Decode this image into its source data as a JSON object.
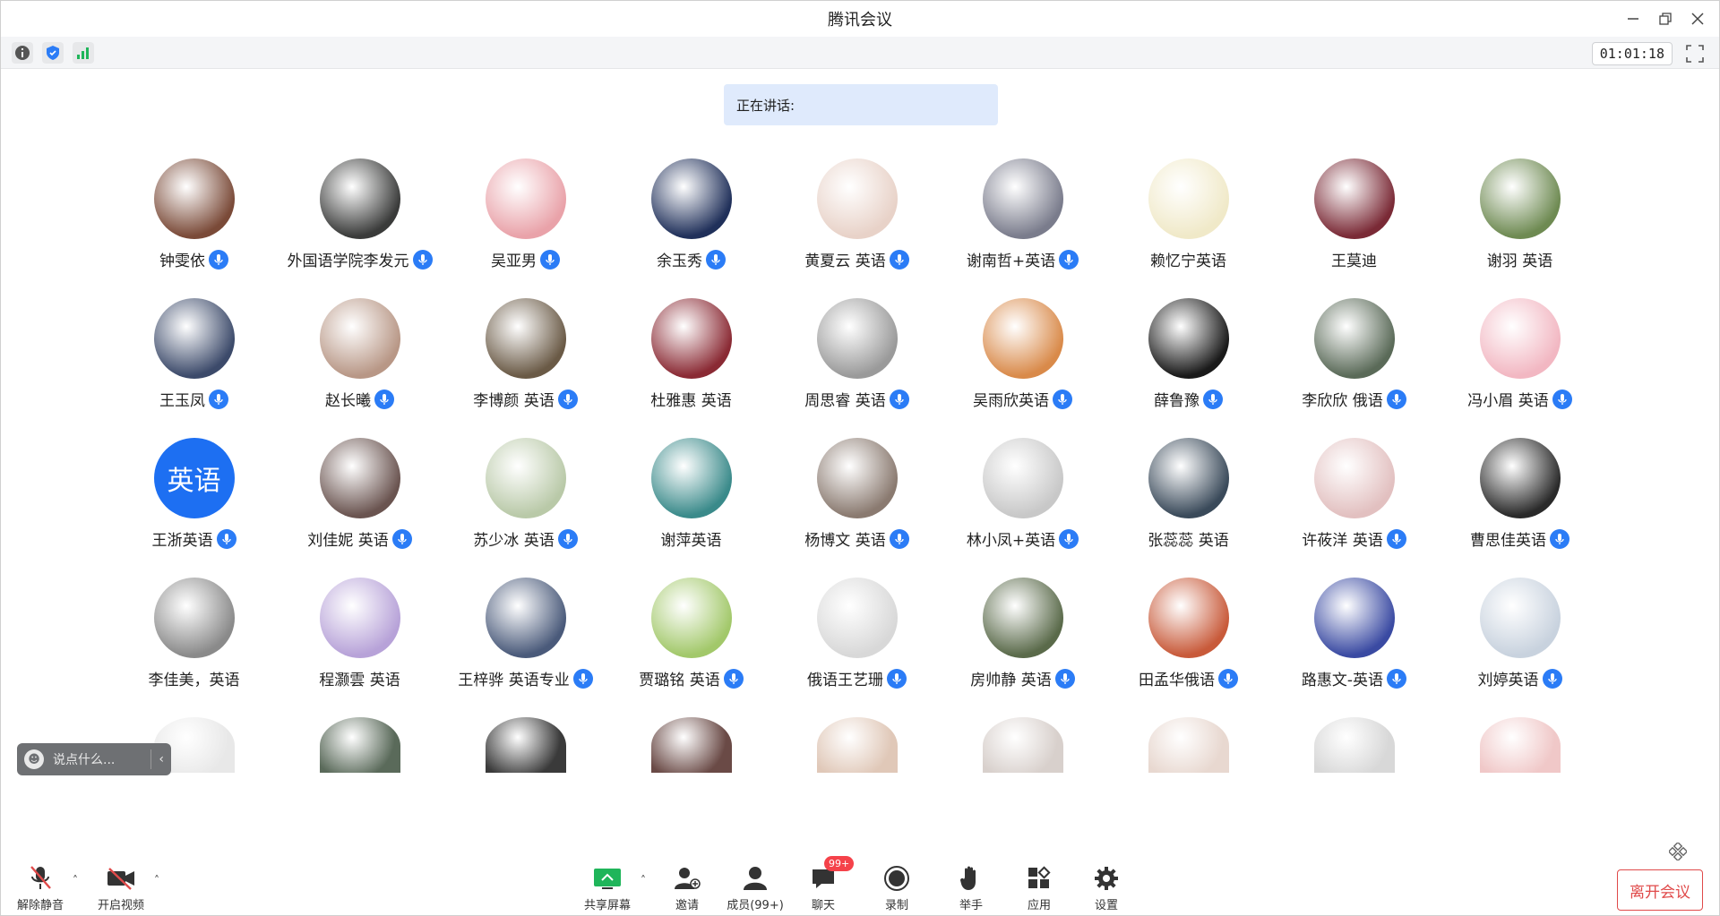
{
  "window": {
    "title": "腾讯会议"
  },
  "toolbar": {
    "timer": "01:01:18"
  },
  "speaking": {
    "label": "正在讲话:"
  },
  "participants": [
    {
      "name": "钟雯依",
      "mic": true,
      "color": "#7a4a38"
    },
    {
      "name": "外国语学院李发元",
      "mic": true,
      "color": "#3a3b3a"
    },
    {
      "name": "吴亚男",
      "mic": true,
      "color": "#e9a2a9"
    },
    {
      "name": "余玉秀",
      "mic": true,
      "color": "#20305a"
    },
    {
      "name": "黄夏云 英语",
      "mic": true,
      "color": "#e8d2c8"
    },
    {
      "name": "谢南哲+英语",
      "mic": true,
      "color": "#7a7c8c"
    },
    {
      "name": "赖忆宁英语",
      "mic": false,
      "color": "#f0e9c8"
    },
    {
      "name": "王莫迪",
      "mic": false,
      "color": "#7a2a36"
    },
    {
      "name": "谢羽 英语",
      "mic": false,
      "color": "#6e8a52"
    },
    {
      "name": "王玉凤",
      "mic": true,
      "color": "#3c4a6a"
    },
    {
      "name": "赵长曦",
      "mic": true,
      "color": "#b89786"
    },
    {
      "name": "李博颜 英语",
      "mic": true,
      "color": "#6a5a46"
    },
    {
      "name": "杜雅惠 英语",
      "mic": false,
      "color": "#8a2a34"
    },
    {
      "name": "周思睿 英语",
      "mic": true,
      "color": "#9a9a9a"
    },
    {
      "name": "吴雨欣英语",
      "mic": true,
      "color": "#d98a4a"
    },
    {
      "name": "薛鲁豫",
      "mic": true,
      "color": "#1a1a1a"
    },
    {
      "name": "李欣欣 俄语",
      "mic": true,
      "color": "#5a6a58"
    },
    {
      "name": "冯小眉 英语",
      "mic": true,
      "color": "#f2b7c2"
    },
    {
      "name": "王浙英语",
      "mic": true,
      "color": "#1d6ff2",
      "avatar_text": "英语"
    },
    {
      "name": "刘佳妮 英语",
      "mic": true,
      "color": "#6a5450"
    },
    {
      "name": "苏少冰 英语",
      "mic": true,
      "color": "#b9c9a8"
    },
    {
      "name": "谢萍英语",
      "mic": false,
      "color": "#3a8a8a"
    },
    {
      "name": "杨博文 英语",
      "mic": true,
      "color": "#8a7a70"
    },
    {
      "name": "林小凤+英语",
      "mic": true,
      "color": "#c8c8c8"
    },
    {
      "name": "张蕊蕊 英语",
      "mic": false,
      "color": "#3a4a5a"
    },
    {
      "name": "许莜洋 英语",
      "mic": true,
      "color": "#e2c0c0"
    },
    {
      "name": "曹思佳英语",
      "mic": true,
      "color": "#2a2a2a"
    },
    {
      "name": "李佳美，英语",
      "mic": false,
      "color": "#8a8a8a"
    },
    {
      "name": "程灏雲 英语",
      "mic": false,
      "color": "#b7a2d8"
    },
    {
      "name": "王梓骅 英语专业",
      "mic": true,
      "color": "#4a5a7a"
    },
    {
      "name": "贾璐铭 英语",
      "mic": true,
      "color": "#a2c86a"
    },
    {
      "name": "俄语王艺珊",
      "mic": true,
      "color": "#d8d8d8"
    },
    {
      "name": "房帅静 英语",
      "mic": true,
      "color": "#5a6a4a"
    },
    {
      "name": "田孟华俄语",
      "mic": true,
      "color": "#c85a3a"
    },
    {
      "name": "路惠文-英语",
      "mic": true,
      "color": "#3a4aa2"
    },
    {
      "name": "刘婷英语",
      "mic": true,
      "color": "#c8d2de"
    }
  ],
  "partial_row": [
    {
      "color": "#e8e8e8"
    },
    {
      "color": "#5a6a5a"
    },
    {
      "color": "#3a3a3a"
    },
    {
      "color": "#6a4a46"
    },
    {
      "color": "#e0c8b8"
    },
    {
      "color": "#d8d0cc"
    },
    {
      "color": "#e8d8d0"
    },
    {
      "color": "#d8d8d8"
    },
    {
      "color": "#f0c8c8"
    }
  ],
  "chat": {
    "placeholder": "说点什么..."
  },
  "bottom": {
    "unmute": "解除静音",
    "video": "开启视频",
    "share": "共享屏幕",
    "invite": "邀请",
    "members": "成员(99+)",
    "chat": "聊天",
    "chat_badge": "99+",
    "record": "录制",
    "raise_hand": "举手",
    "apps": "应用",
    "settings": "设置",
    "leave": "离开会议"
  },
  "colors": {
    "accent": "#2b7cf6",
    "danger": "#e04a4a",
    "share_green": "#1fb55a"
  }
}
